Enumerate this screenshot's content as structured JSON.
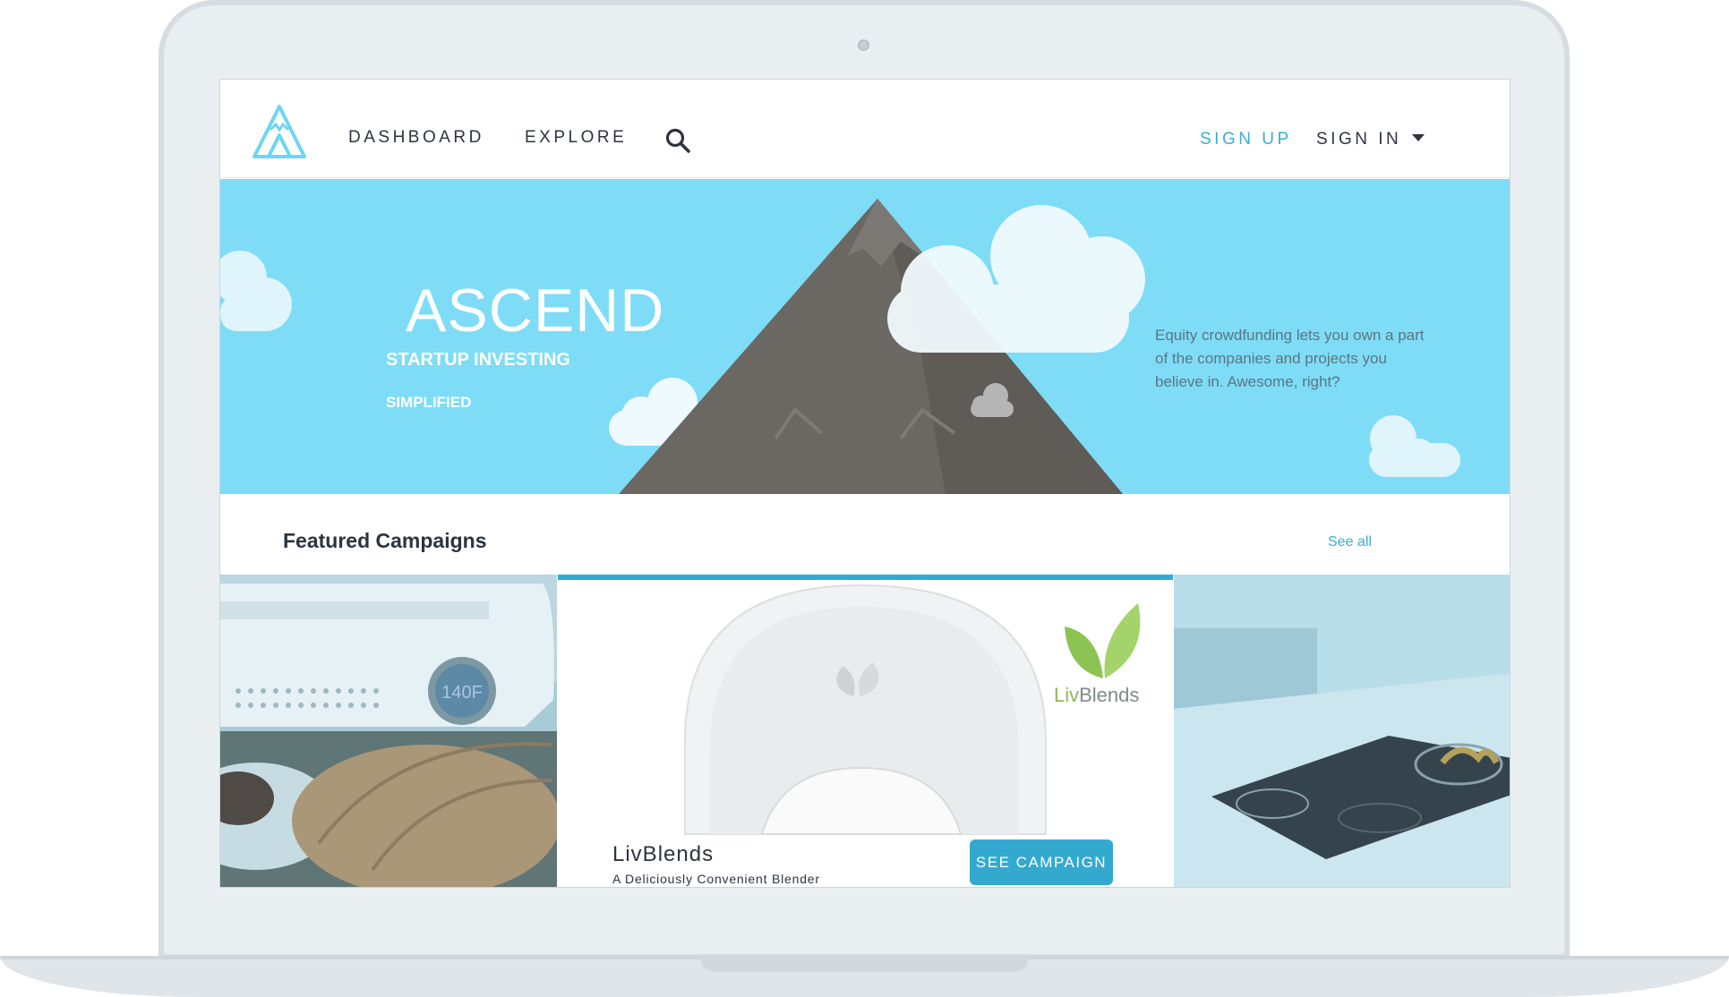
{
  "nav": {
    "dashboard": "DASHBOARD",
    "explore": "EXPLORE",
    "sign_up": "SIGN UP",
    "sign_in": "SIGN IN",
    "search_icon": "search-icon",
    "logo_icon": "mountain-logo-icon"
  },
  "hero": {
    "title": "ASCEND",
    "subtitle_1": "STARTUP INVESTING",
    "subtitle_2": "SIMPLIFIED",
    "description": "Equity crowdfunding lets you own a part of the companies and projects you believe in. Awesome, right?"
  },
  "featured": {
    "heading": "Featured Campaigns",
    "see_all": "See all",
    "active_card": {
      "brand_prefix": "Liv",
      "brand_suffix": "Blends",
      "name": "LivBlends",
      "tagline": "A Deliciously Convenient Blender",
      "button": "SEE CAMPAIGN"
    },
    "left_card": {
      "display_text": "140F"
    }
  },
  "colors": {
    "accent": "#34a9d0",
    "hero_sky": "#7edcf6",
    "mountain": "#6b6762",
    "text_dark": "#2c3440"
  }
}
